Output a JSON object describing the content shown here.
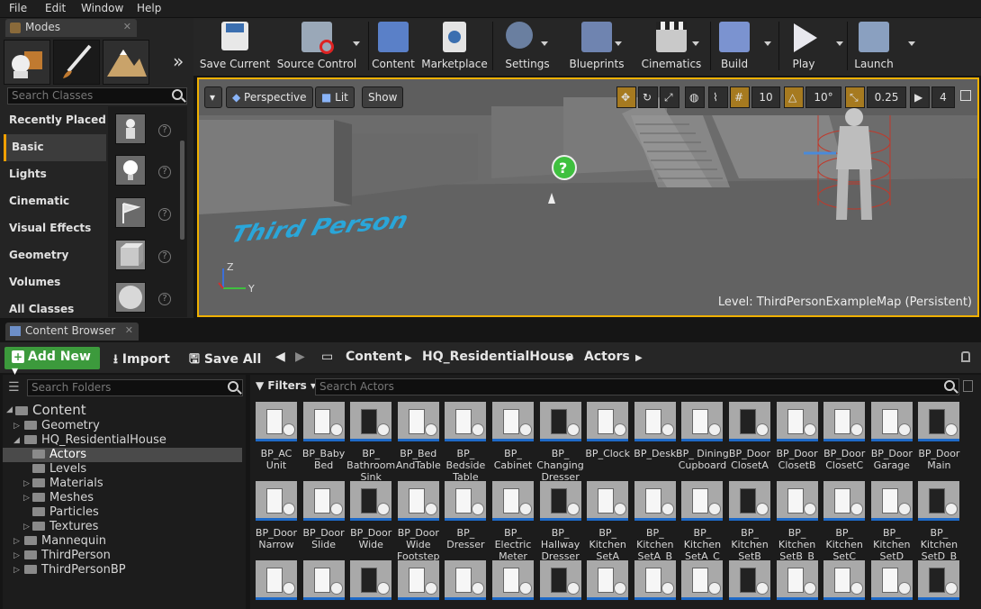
{
  "menu": [
    "File",
    "Edit",
    "Window",
    "Help"
  ],
  "modes": {
    "tab_label": "Modes",
    "search_placeholder": "Search Classes",
    "categories": [
      "Recently Placed",
      "Basic",
      "Lights",
      "Cinematic",
      "Visual Effects",
      "Geometry",
      "Volumes",
      "All Classes"
    ],
    "selected_category": "Basic"
  },
  "toolbar": {
    "buttons": [
      "Save Current",
      "Source Control",
      "Content",
      "Marketplace",
      "Settings",
      "Blueprints",
      "Cinematics",
      "Build",
      "Play",
      "Launch"
    ]
  },
  "viewport": {
    "perspective": "Perspective",
    "lit": "Lit",
    "show": "Show",
    "grid_snap": "10",
    "rot_snap": "10°",
    "scale_snap": "0.25",
    "cam_speed": "4",
    "level_label": "Level:",
    "level_name": "ThirdPersonExampleMap (Persistent)",
    "floor_text": "Third Person",
    "axis_z": "Z",
    "axis_y": "Y"
  },
  "content_browser": {
    "tab_label": "Content Browser",
    "add_new": "Add New",
    "import": "Import",
    "save_all": "Save All",
    "breadcrumbs": [
      "Content",
      "HQ_ResidentialHouse",
      "Actors"
    ],
    "folder_search_placeholder": "Search Folders",
    "filters": "Filters",
    "asset_search_placeholder": "Search Actors",
    "tree": [
      {
        "label": "Content",
        "depth": 0,
        "expanded": true
      },
      {
        "label": "Geometry",
        "depth": 1,
        "expanded": false
      },
      {
        "label": "HQ_ResidentialHouse",
        "depth": 1,
        "expanded": true
      },
      {
        "label": "Actors",
        "depth": 2,
        "selected": true
      },
      {
        "label": "Levels",
        "depth": 2
      },
      {
        "label": "Materials",
        "depth": 2,
        "expanded": false
      },
      {
        "label": "Meshes",
        "depth": 2,
        "expanded": false
      },
      {
        "label": "Particles",
        "depth": 2
      },
      {
        "label": "Textures",
        "depth": 2,
        "expanded": false
      },
      {
        "label": "Mannequin",
        "depth": 1,
        "expanded": false
      },
      {
        "label": "ThirdPerson",
        "depth": 1,
        "expanded": false
      },
      {
        "label": "ThirdPersonBP",
        "depth": 1,
        "expanded": false
      }
    ],
    "assets_row1": [
      "BP_AC Unit",
      "BP_Baby Bed",
      "BP_ Bathroom Sink",
      "BP_Bed AndTable",
      "BP_ Bedside Table",
      "BP_ Cabinet",
      "BP_ Changing Dresser",
      "BP_Clock",
      "BP_Desk",
      "BP_ Dining Cupboard",
      "BP_Door ClosetA",
      "BP_Door ClosetB",
      "BP_Door ClosetC",
      "BP_Door Garage",
      "BP_Door Main"
    ],
    "assets_row2": [
      "BP_Door Narrow",
      "BP_Door Slide",
      "BP_Door Wide",
      "BP_Door Wide Footstep",
      "BP_ Dresser",
      "BP_ Electric Meter",
      "BP_ Hallway Dresser",
      "BP_ Kitchen SetA",
      "BP_ Kitchen SetA_B",
      "BP_ Kitchen SetA_C",
      "BP_ Kitchen SetB",
      "BP_ Kitchen SetB_B",
      "BP_ Kitchen SetC",
      "BP_ Kitchen SetD",
      "BP_ Kitchen SetD_B"
    ]
  }
}
